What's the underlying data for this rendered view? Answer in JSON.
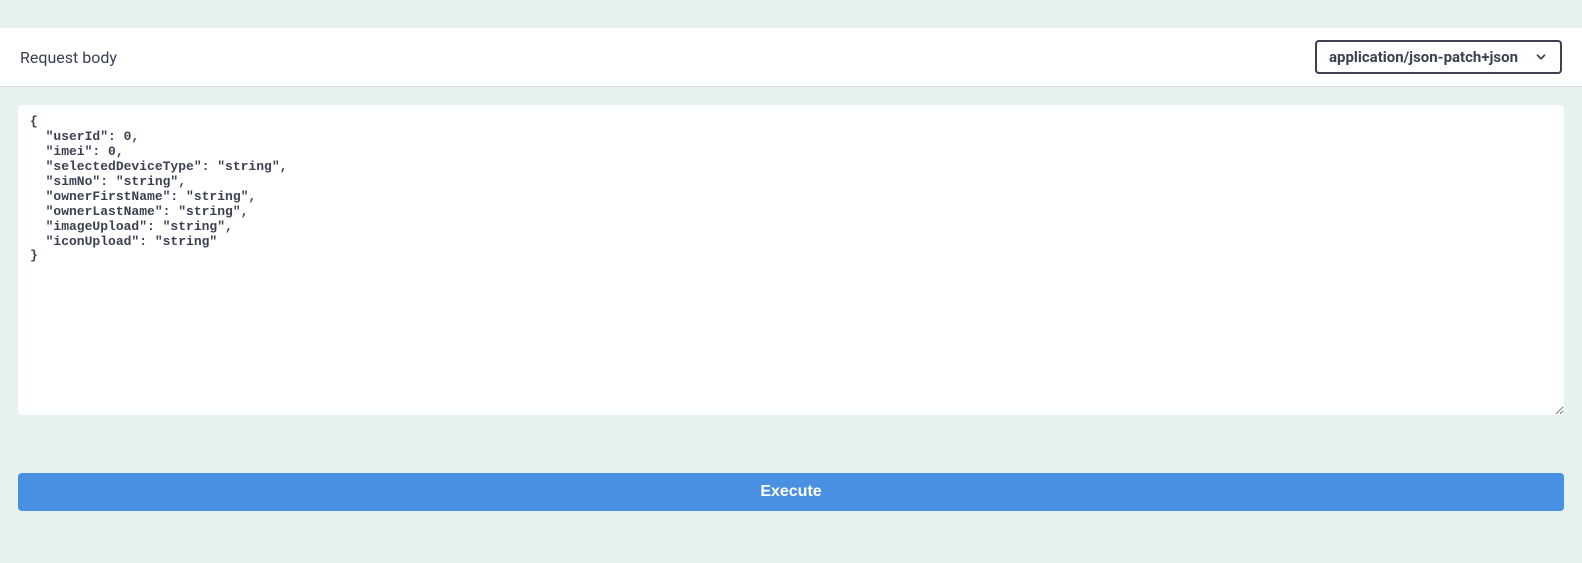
{
  "requestBody": {
    "label": "Request body",
    "contentType": "application/json-patch+json",
    "payload": "{\n  \"userId\": 0,\n  \"imei\": 0,\n  \"selectedDeviceType\": \"string\",\n  \"simNo\": \"string\",\n  \"ownerFirstName\": \"string\",\n  \"ownerLastName\": \"string\",\n  \"imageUpload\": \"string\",\n  \"iconUpload\": \"string\"\n}"
  },
  "actions": {
    "executeLabel": "Execute"
  }
}
